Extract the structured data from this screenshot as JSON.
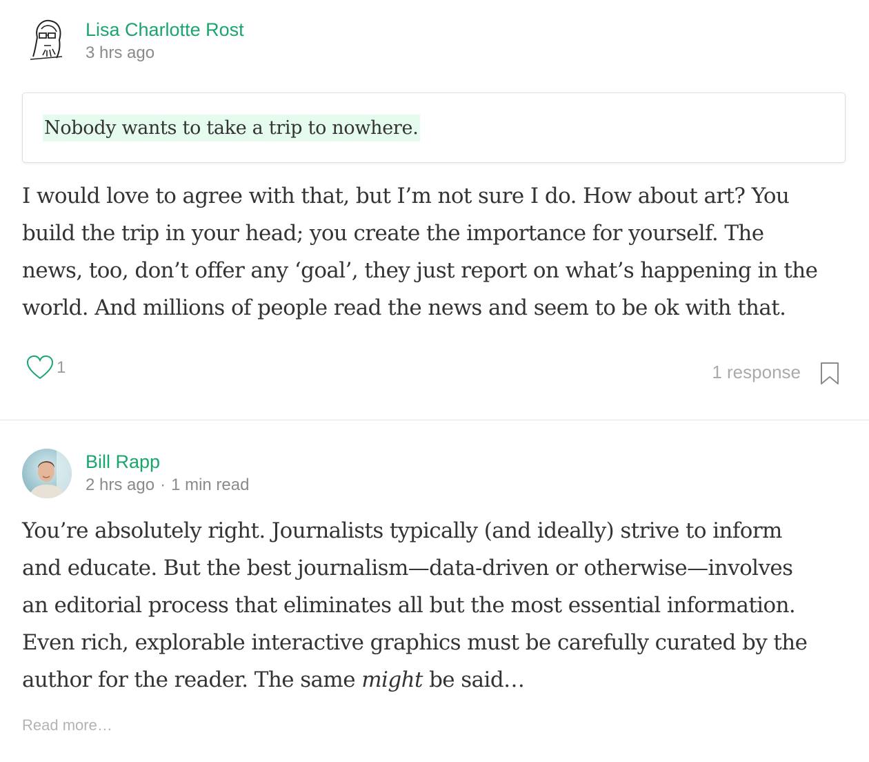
{
  "post1": {
    "author": "Lisa Charlotte Rost",
    "time": "3 hrs ago",
    "quote": "Nobody wants to take a trip to nowhere.",
    "body": [
      "I would love to agree with that, but I’m not sure I do. How about art? You",
      "build the trip in your head; you create the importance for yourself. The",
      "news, too, don’t offer any ‘goal’, they just report on what’s happening in the",
      "world. And millions of people read the news and seem to be ok with that."
    ],
    "likes": "1",
    "responses": "1 response"
  },
  "post2": {
    "author": "Bill Rapp",
    "time": "2 hrs ago",
    "separator": "·",
    "read_time": "1 min read",
    "body": [
      "You’re absolutely right. Journalists typically (and ideally) strive to inform",
      "and educate. But the best journalism—data-driven or otherwise—involves",
      "an editorial process that eliminates all but the most essential information.",
      "Even rich, explorable interactive graphics must be carefully curated by the"
    ],
    "body_last_before": "author for the reader. The same ",
    "body_last_em": "might",
    "body_last_after": " be said…",
    "read_more": "Read more…"
  },
  "icons": {
    "heart": "heart-icon",
    "bookmark": "bookmark-icon"
  },
  "colors": {
    "accent": "#1aa56d",
    "highlight": "#e5fbed",
    "muted": "#8a8a8a"
  }
}
